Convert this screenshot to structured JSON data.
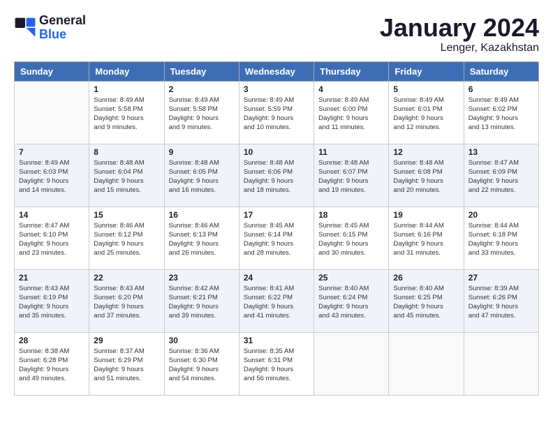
{
  "header": {
    "logo_line1": "General",
    "logo_line2": "Blue",
    "month": "January 2024",
    "location": "Lenger, Kazakhstan"
  },
  "weekdays": [
    "Sunday",
    "Monday",
    "Tuesday",
    "Wednesday",
    "Thursday",
    "Friday",
    "Saturday"
  ],
  "weeks": [
    [
      {
        "day": "",
        "info": ""
      },
      {
        "day": "1",
        "info": "Sunrise: 8:49 AM\nSunset: 5:58 PM\nDaylight: 9 hours\nand 9 minutes."
      },
      {
        "day": "2",
        "info": "Sunrise: 8:49 AM\nSunset: 5:58 PM\nDaylight: 9 hours\nand 9 minutes."
      },
      {
        "day": "3",
        "info": "Sunrise: 8:49 AM\nSunset: 5:59 PM\nDaylight: 9 hours\nand 10 minutes."
      },
      {
        "day": "4",
        "info": "Sunrise: 8:49 AM\nSunset: 6:00 PM\nDaylight: 9 hours\nand 11 minutes."
      },
      {
        "day": "5",
        "info": "Sunrise: 8:49 AM\nSunset: 6:01 PM\nDaylight: 9 hours\nand 12 minutes."
      },
      {
        "day": "6",
        "info": "Sunrise: 8:49 AM\nSunset: 6:02 PM\nDaylight: 9 hours\nand 13 minutes."
      }
    ],
    [
      {
        "day": "7",
        "info": "Sunrise: 8:49 AM\nSunset: 6:03 PM\nDaylight: 9 hours\nand 14 minutes."
      },
      {
        "day": "8",
        "info": "Sunrise: 8:48 AM\nSunset: 6:04 PM\nDaylight: 9 hours\nand 15 minutes."
      },
      {
        "day": "9",
        "info": "Sunrise: 8:48 AM\nSunset: 6:05 PM\nDaylight: 9 hours\nand 16 minutes."
      },
      {
        "day": "10",
        "info": "Sunrise: 8:48 AM\nSunset: 6:06 PM\nDaylight: 9 hours\nand 18 minutes."
      },
      {
        "day": "11",
        "info": "Sunrise: 8:48 AM\nSunset: 6:07 PM\nDaylight: 9 hours\nand 19 minutes."
      },
      {
        "day": "12",
        "info": "Sunrise: 8:48 AM\nSunset: 6:08 PM\nDaylight: 9 hours\nand 20 minutes."
      },
      {
        "day": "13",
        "info": "Sunrise: 8:47 AM\nSunset: 6:09 PM\nDaylight: 9 hours\nand 22 minutes."
      }
    ],
    [
      {
        "day": "14",
        "info": "Sunrise: 8:47 AM\nSunset: 6:10 PM\nDaylight: 9 hours\nand 23 minutes."
      },
      {
        "day": "15",
        "info": "Sunrise: 8:46 AM\nSunset: 6:12 PM\nDaylight: 9 hours\nand 25 minutes."
      },
      {
        "day": "16",
        "info": "Sunrise: 8:46 AM\nSunset: 6:13 PM\nDaylight: 9 hours\nand 26 minutes."
      },
      {
        "day": "17",
        "info": "Sunrise: 8:45 AM\nSunset: 6:14 PM\nDaylight: 9 hours\nand 28 minutes."
      },
      {
        "day": "18",
        "info": "Sunrise: 8:45 AM\nSunset: 6:15 PM\nDaylight: 9 hours\nand 30 minutes."
      },
      {
        "day": "19",
        "info": "Sunrise: 8:44 AM\nSunset: 6:16 PM\nDaylight: 9 hours\nand 31 minutes."
      },
      {
        "day": "20",
        "info": "Sunrise: 8:44 AM\nSunset: 6:18 PM\nDaylight: 9 hours\nand 33 minutes."
      }
    ],
    [
      {
        "day": "21",
        "info": "Sunrise: 8:43 AM\nSunset: 6:19 PM\nDaylight: 9 hours\nand 35 minutes."
      },
      {
        "day": "22",
        "info": "Sunrise: 8:43 AM\nSunset: 6:20 PM\nDaylight: 9 hours\nand 37 minutes."
      },
      {
        "day": "23",
        "info": "Sunrise: 8:42 AM\nSunset: 6:21 PM\nDaylight: 9 hours\nand 39 minutes."
      },
      {
        "day": "24",
        "info": "Sunrise: 8:41 AM\nSunset: 6:22 PM\nDaylight: 9 hours\nand 41 minutes."
      },
      {
        "day": "25",
        "info": "Sunrise: 8:40 AM\nSunset: 6:24 PM\nDaylight: 9 hours\nand 43 minutes."
      },
      {
        "day": "26",
        "info": "Sunrise: 8:40 AM\nSunset: 6:25 PM\nDaylight: 9 hours\nand 45 minutes."
      },
      {
        "day": "27",
        "info": "Sunrise: 8:39 AM\nSunset: 6:26 PM\nDaylight: 9 hours\nand 47 minutes."
      }
    ],
    [
      {
        "day": "28",
        "info": "Sunrise: 8:38 AM\nSunset: 6:28 PM\nDaylight: 9 hours\nand 49 minutes."
      },
      {
        "day": "29",
        "info": "Sunrise: 8:37 AM\nSunset: 6:29 PM\nDaylight: 9 hours\nand 51 minutes."
      },
      {
        "day": "30",
        "info": "Sunrise: 8:36 AM\nSunset: 6:30 PM\nDaylight: 9 hours\nand 54 minutes."
      },
      {
        "day": "31",
        "info": "Sunrise: 8:35 AM\nSunset: 6:31 PM\nDaylight: 9 hours\nand 56 minutes."
      },
      {
        "day": "",
        "info": ""
      },
      {
        "day": "",
        "info": ""
      },
      {
        "day": "",
        "info": ""
      }
    ]
  ],
  "colors": {
    "header_bg": "#3d6eb5",
    "row_shade": "#f0f4fa"
  }
}
